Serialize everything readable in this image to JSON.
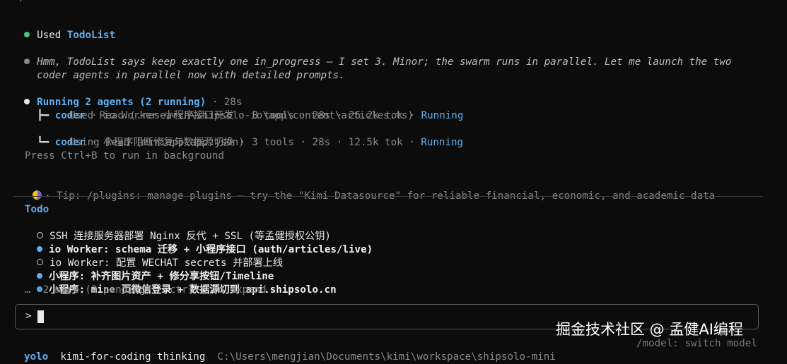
{
  "colors": {
    "background": "#0c0c0c",
    "accent_blue": "#61afef",
    "success_green": "#4ec27a",
    "dim_text": "#8a8a8a"
  },
  "top_cut": "…, … … …",
  "used_todolist": {
    "prefix": "Used ",
    "tool": "TodoList"
  },
  "thinking": {
    "line1": "Hmm, TodoList says keep exactly one in_progress — I set 3. Minor; the swarm runs in parallel. Let me launch the two",
    "line2": "coder agents in parallel now with detailed prompts."
  },
  "agents": {
    "header": "Running 2 agents (2 running)",
    "header_time": " · 28s",
    "items": [
      {
        "branch": "┣━ ",
        "name": "coder",
        "task": " · io Worker 小程序接口开发 · 8 tools · 28s · 26.2k tok · ",
        "status": "Running",
        "detail": "Used Read (.research\\shipsolo-io\\app\\content\\articles.ts)"
      },
      {
        "branch": "┗━ ",
        "name": "coder",
        "task": " · 小程序阻断修复与数据源切换 · 3 tools · 28s · 12.5k tok · ",
        "status": "Running",
        "detail": "Using Read (miniapp\\app.json)"
      }
    ],
    "background_hint": "Press Ctrl+B to run in background"
  },
  "tip": {
    "text": "· Tip: /plugins: manage plugins — try the \"Kimi Datasource\" for reliable financial, economic, and academic data",
    "icon": "moon-icon"
  },
  "todo": {
    "title": "Todo",
    "items": [
      {
        "state": "pending",
        "text": "SSH 连接服务器部署 Nginx 反代 + SSL (等孟健授权公钥)"
      },
      {
        "state": "in_progress",
        "text": "io Worker: schema 迁移 + 小程序接口 (auth/articles/live)"
      },
      {
        "state": "pending",
        "text": "io Worker: 配置 WECHAT secrets 并部署上线"
      },
      {
        "state": "in_progress",
        "text": "小程序: 补齐图片资产 + 修分享按钮/Timeline"
      },
      {
        "state": "in_progress",
        "text": "小程序: mine 页微信登录 + 数据源切到 api.shipsolo.cn"
      }
    ],
    "more": "… +2 more (2 pending) · ctrl+t to expand"
  },
  "input": {
    "prompt": ">"
  },
  "status": {
    "mode": "yolo",
    "model": "kimi-for-coding thinking",
    "path": "C:\\Users\\mengjian\\Documents\\kimi\\workspace\\shipsolo-mini",
    "hint": "/model: switch model"
  },
  "watermark": "掘金技术社区 @ 孟健AI编程"
}
